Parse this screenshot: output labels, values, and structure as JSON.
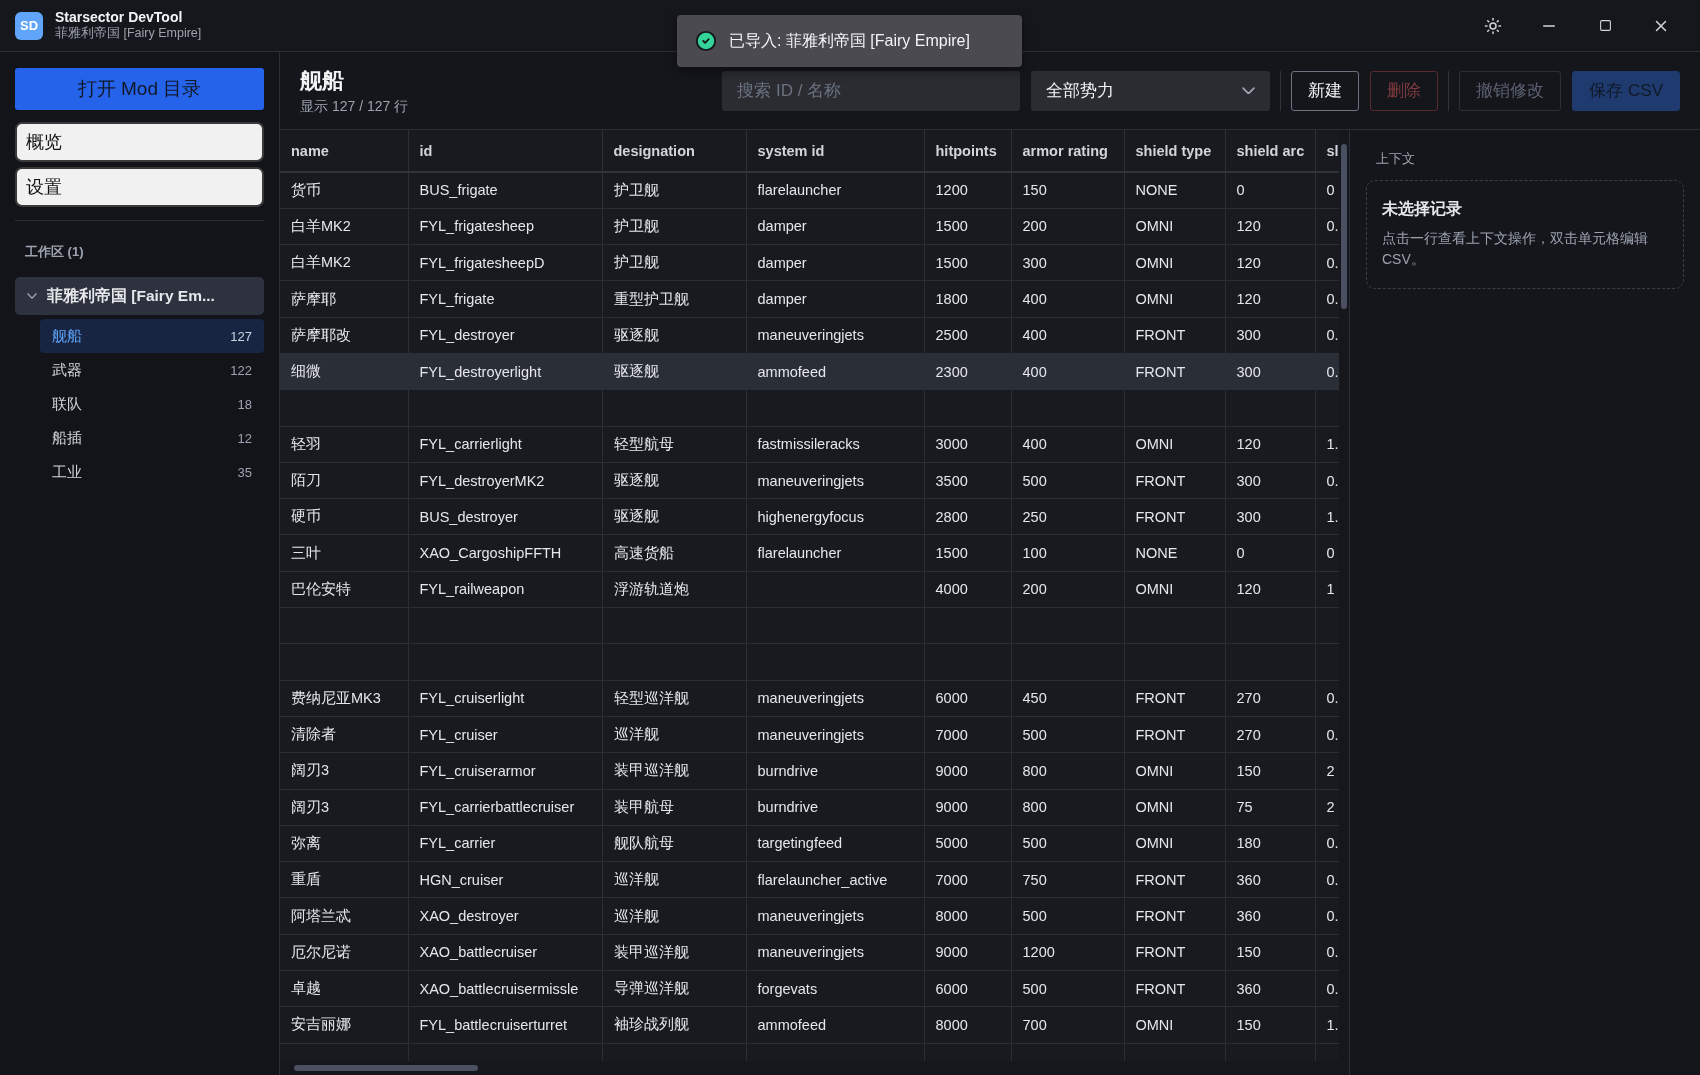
{
  "app": {
    "logo": "SD",
    "title": "Starsector DevTool",
    "subtitle": "菲雅利帝国 [Fairy Empire]"
  },
  "toast": {
    "message": "已导入: 菲雅利帝国 [Fairy Empire]"
  },
  "sidebar": {
    "open_button": "打开 Mod 目录",
    "nav": [
      {
        "label": "概览"
      },
      {
        "label": "设置"
      }
    ],
    "workspace_label": "工作区 (1)",
    "tree": [
      {
        "label": "菲雅利帝国 [Fairy Em...",
        "expanded": true,
        "children": [
          {
            "label": "舰船",
            "count": "127",
            "selected": true
          },
          {
            "label": "武器",
            "count": "122",
            "selected": false
          },
          {
            "label": "联队",
            "count": "18",
            "selected": false
          },
          {
            "label": "船插",
            "count": "12",
            "selected": false
          },
          {
            "label": "工业",
            "count": "35",
            "selected": false
          }
        ]
      }
    ]
  },
  "header": {
    "title": "舰船",
    "subtitle": "显示 127 / 127 行",
    "search": {
      "placeholder": "搜索 ID / 名称"
    },
    "filter": {
      "value": "全部势力"
    },
    "button_groups": [
      [
        {
          "label": "新建",
          "kind": "outline",
          "disabled": false
        },
        {
          "label": "删除",
          "kind": "danger",
          "disabled": true
        }
      ],
      [
        {
          "label": "撤销修改",
          "kind": "outline",
          "disabled": true
        },
        {
          "label": "保存 CSV",
          "kind": "primary",
          "disabled": true
        }
      ]
    ]
  },
  "table": {
    "columns": [
      "name",
      "id",
      "designation",
      "system id",
      "hitpoints",
      "armor rating",
      "shield type",
      "shield arc",
      "sl"
    ],
    "rows": [
      {
        "cells": [
          "货币",
          "BUS_frigate",
          "护卫舰",
          "flarelauncher",
          "1200",
          "150",
          "NONE",
          "0",
          "0"
        ],
        "selected": false
      },
      {
        "cells": [
          "白羊MK2",
          "FYL_frigatesheep",
          "护卫舰",
          "damper",
          "1500",
          "200",
          "OMNI",
          "120",
          "0."
        ],
        "selected": false
      },
      {
        "cells": [
          "白羊MK2",
          "FYL_frigatesheepD",
          "护卫舰",
          "damper",
          "1500",
          "300",
          "OMNI",
          "120",
          "0."
        ],
        "selected": false
      },
      {
        "cells": [
          "萨摩耶",
          "FYL_frigate",
          "重型护卫舰",
          "damper",
          "1800",
          "400",
          "OMNI",
          "120",
          "0."
        ],
        "selected": false
      },
      {
        "cells": [
          "萨摩耶改",
          "FYL_destroyer",
          "驱逐舰",
          "maneuveringjets",
          "2500",
          "400",
          "FRONT",
          "300",
          "0."
        ],
        "selected": false
      },
      {
        "cells": [
          "细微",
          "FYL_destroyerlight",
          "驱逐舰",
          "ammofeed",
          "2300",
          "400",
          "FRONT",
          "300",
          "0."
        ],
        "selected": true
      },
      {
        "kind": "blank",
        "selected": false
      },
      {
        "cells": [
          "轻羽",
          "FYL_carrierlight",
          "轻型航母",
          "fastmissileracks",
          "3000",
          "400",
          "OMNI",
          "120",
          "1."
        ],
        "selected": false
      },
      {
        "cells": [
          "陌刀",
          "FYL_destroyerMK2",
          "驱逐舰",
          "maneuveringjets",
          "3500",
          "500",
          "FRONT",
          "300",
          "0."
        ],
        "selected": false
      },
      {
        "cells": [
          "硬币",
          "BUS_destroyer",
          "驱逐舰",
          "highenergyfocus",
          "2800",
          "250",
          "FRONT",
          "300",
          "1."
        ],
        "selected": false
      },
      {
        "cells": [
          "三叶",
          "XAO_CargoshipFFTH",
          "高速货船",
          "flarelauncher",
          "1500",
          "100",
          "NONE",
          "0",
          "0"
        ],
        "selected": false
      },
      {
        "cells": [
          "巴伦安特",
          "FYL_railweapon",
          "浮游轨道炮",
          null,
          "4000",
          "200",
          "OMNI",
          "120",
          "1"
        ],
        "selected": false
      },
      {
        "kind": "blank",
        "selected": false
      },
      {
        "kind": "blank",
        "selected": false
      },
      {
        "cells": [
          "费纳尼亚MK3",
          "FYL_cruiserlight",
          "轻型巡洋舰",
          "maneuveringjets",
          "6000",
          "450",
          "FRONT",
          "270",
          "0."
        ],
        "selected": false
      },
      {
        "cells": [
          "清除者",
          "FYL_cruiser",
          "巡洋舰",
          "maneuveringjets",
          "7000",
          "500",
          "FRONT",
          "270",
          "0."
        ],
        "selected": false
      },
      {
        "cells": [
          "阔刃3",
          "FYL_cruiserarmor",
          "装甲巡洋舰",
          "burndrive",
          "9000",
          "800",
          "OMNI",
          "150",
          "2"
        ],
        "selected": false
      },
      {
        "cells": [
          "阔刃3",
          "FYL_carrierbattlecruiser",
          "装甲航母",
          "burndrive",
          "9000",
          "800",
          "OMNI",
          "75",
          "2"
        ],
        "selected": false
      },
      {
        "cells": [
          "弥离",
          "FYL_carrier",
          "舰队航母",
          "targetingfeed",
          "5000",
          "500",
          "OMNI",
          "180",
          "0."
        ],
        "selected": false
      },
      {
        "cells": [
          "重盾",
          "HGN_cruiser",
          "巡洋舰",
          "flarelauncher_active",
          "7000",
          "750",
          "FRONT",
          "360",
          "0."
        ],
        "selected": false
      },
      {
        "cells": [
          "阿塔兰忒",
          "XAO_destroyer",
          "巡洋舰",
          "maneuveringjets",
          "8000",
          "500",
          "FRONT",
          "360",
          "0."
        ],
        "selected": false
      },
      {
        "cells": [
          "厄尔尼诺",
          "XAO_battlecruiser",
          "装甲巡洋舰",
          "maneuveringjets",
          "9000",
          "1200",
          "FRONT",
          "150",
          "0."
        ],
        "selected": false
      },
      {
        "cells": [
          "卓越",
          "XAO_battlecruisermissle",
          "导弹巡洋舰",
          "forgevats",
          "6000",
          "500",
          "FRONT",
          "360",
          "0."
        ],
        "selected": false
      },
      {
        "cells": [
          "安吉丽娜",
          "FYL_battlecruiserturret",
          "袖珍战列舰",
          "ammofeed",
          "8000",
          "700",
          "OMNI",
          "150",
          "1."
        ],
        "selected": false
      },
      {
        "kind": "blank",
        "selected": false
      }
    ]
  },
  "context": {
    "label": "上下文",
    "card_title": "未选择记录",
    "card_text": "点击一行查看上下文操作，双击单元格编辑CSV。"
  }
}
